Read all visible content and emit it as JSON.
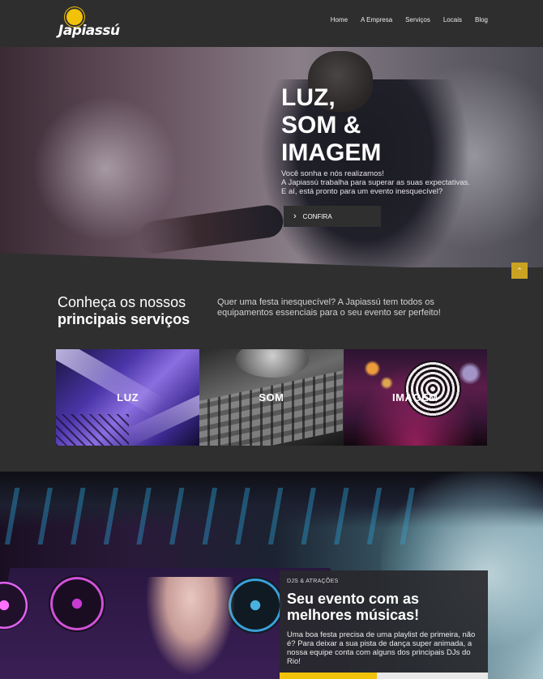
{
  "header": {
    "logo_text": "Japiassú",
    "nav": [
      "Home",
      "A Empresa",
      "Serviços",
      "Locais",
      "Blog"
    ]
  },
  "hero": {
    "title_lines": [
      "LUZ,",
      "SOM &",
      "IMAGEM"
    ],
    "subtitle_lines": [
      "Você sonha e nós realizamos!",
      "A Japiassú trabalha para superar as suas expectativas.",
      "E aí, está pronto para um evento inesquecível?"
    ],
    "cta_label": "CONFIRA",
    "scroll_top_icon": "arrow-up-icon"
  },
  "services": {
    "title_line1": "Conheça os nossos",
    "title_line2": "principais serviços",
    "description_lines": [
      "Quer uma festa inesquecível? A Japiassú tem todos os",
      "equipamentos essenciais para o seu evento ser perfeito!"
    ],
    "cards": [
      {
        "label": "LUZ"
      },
      {
        "label": "SOM"
      },
      {
        "label": "IMAGEM"
      }
    ]
  },
  "djs": {
    "tag": "DJS & ATRAÇÕES",
    "title_lines": [
      "Seu evento com as",
      "melhores músicas!"
    ],
    "text_lines": [
      "Uma boa festa precisa de uma playlist de primeira, não",
      "é? Para deixar a sua pista de dança super animada, a",
      "nossa equipe conta com alguns dos principais DJs do",
      "Rio!"
    ]
  },
  "colors": {
    "accent": "#f2c20a",
    "dark": "#2f2f2f",
    "scroll_button": "#caa322"
  }
}
